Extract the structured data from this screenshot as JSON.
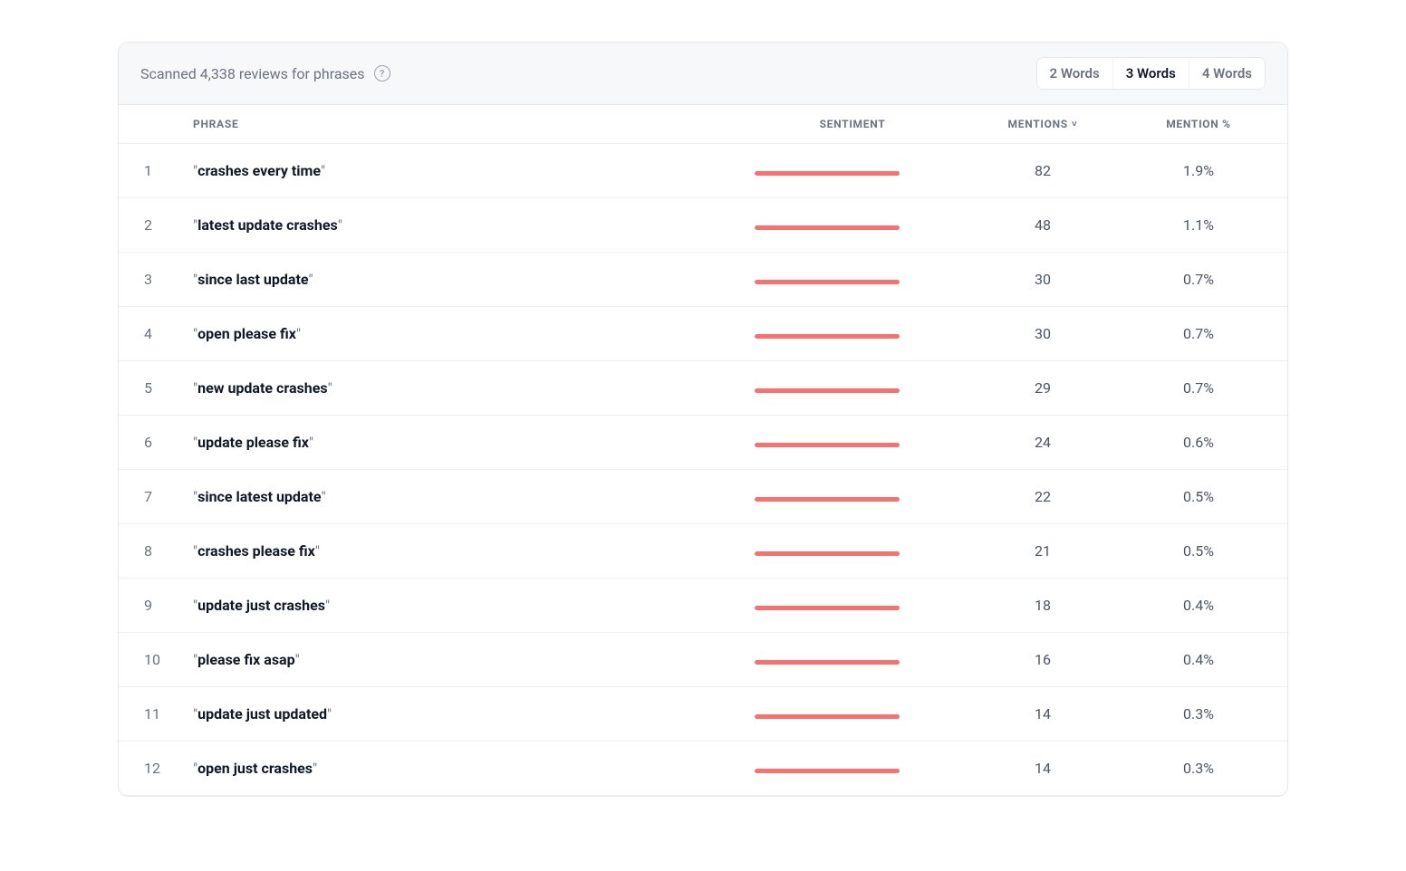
{
  "header": {
    "scanned_text": "Scanned 4,338 reviews for phrases",
    "help_glyph": "?"
  },
  "tabs": [
    {
      "label": "2 Words",
      "active": false
    },
    {
      "label": "3 Words",
      "active": true
    },
    {
      "label": "4 Words",
      "active": false
    }
  ],
  "columns": {
    "phrase": "PHRASE",
    "sentiment": "SENTIMENT",
    "mentions": "MENTIONS",
    "mention_pct": "MENTION %"
  },
  "sort": {
    "column": "mentions",
    "dir": "desc",
    "caret": "˅"
  },
  "sentiment_color": "#f87171",
  "rows": [
    {
      "n": "1",
      "phrase": "crashes every time",
      "sent_width": 160,
      "mentions": "82",
      "pct": "1.9%"
    },
    {
      "n": "2",
      "phrase": "latest update crashes",
      "sent_width": 160,
      "mentions": "48",
      "pct": "1.1%"
    },
    {
      "n": "3",
      "phrase": "since last update",
      "sent_width": 160,
      "mentions": "30",
      "pct": "0.7%"
    },
    {
      "n": "4",
      "phrase": "open please fix",
      "sent_width": 160,
      "mentions": "30",
      "pct": "0.7%"
    },
    {
      "n": "5",
      "phrase": "new update crashes",
      "sent_width": 160,
      "mentions": "29",
      "pct": "0.7%"
    },
    {
      "n": "6",
      "phrase": "update please fix",
      "sent_width": 160,
      "mentions": "24",
      "pct": "0.6%"
    },
    {
      "n": "7",
      "phrase": "since latest update",
      "sent_width": 160,
      "mentions": "22",
      "pct": "0.5%"
    },
    {
      "n": "8",
      "phrase": "crashes please fix",
      "sent_width": 160,
      "mentions": "21",
      "pct": "0.5%"
    },
    {
      "n": "9",
      "phrase": "update just crashes",
      "sent_width": 160,
      "mentions": "18",
      "pct": "0.4%"
    },
    {
      "n": "10",
      "phrase": "please fix asap",
      "sent_width": 160,
      "mentions": "16",
      "pct": "0.4%"
    },
    {
      "n": "11",
      "phrase": "update just updated",
      "sent_width": 160,
      "mentions": "14",
      "pct": "0.3%"
    },
    {
      "n": "12",
      "phrase": "open just crashes",
      "sent_width": 160,
      "mentions": "14",
      "pct": "0.3%"
    }
  ]
}
